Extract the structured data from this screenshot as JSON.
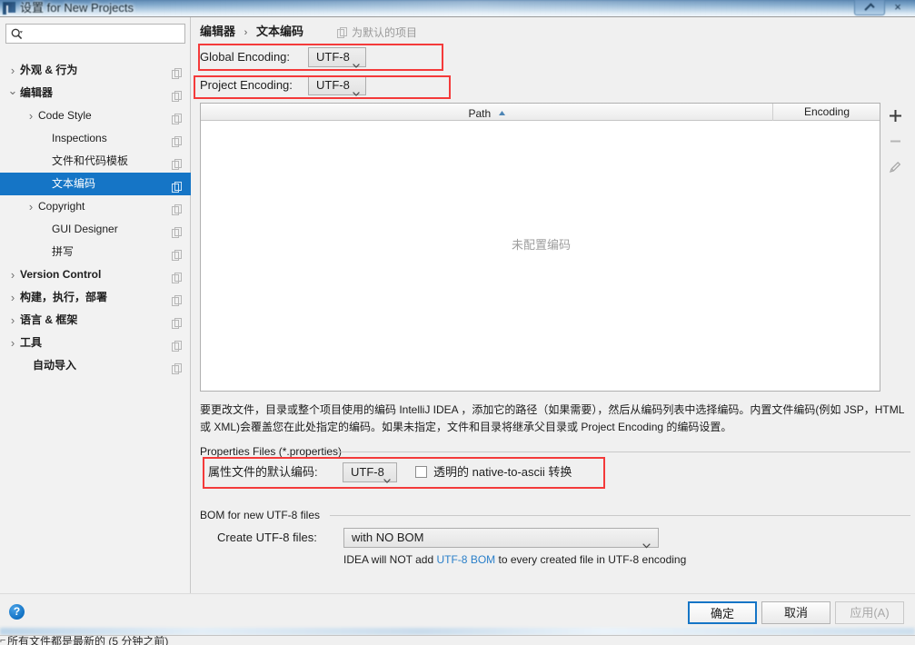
{
  "window": {
    "title": "设置 for New Projects",
    "close_label": "×",
    "app_icon": "intellij-idea-icon"
  },
  "search": {
    "value": "",
    "placeholder": ""
  },
  "sidebar": {
    "items": [
      {
        "label": "外观 & 行为",
        "indent": 8,
        "twist": "collapsed",
        "bold": true,
        "selected": false,
        "copy": true
      },
      {
        "label": "编辑器",
        "indent": 8,
        "twist": "expanded",
        "bold": true,
        "selected": false,
        "copy": true
      },
      {
        "label": "Code Style",
        "indent": 28,
        "twist": "collapsed",
        "bold": false,
        "selected": false,
        "copy": true
      },
      {
        "label": "Inspections",
        "indent": 43,
        "twist": "none",
        "bold": false,
        "selected": false,
        "copy": true
      },
      {
        "label": "文件和代码模板",
        "indent": 43,
        "twist": "none",
        "bold": false,
        "selected": false,
        "copy": true
      },
      {
        "label": "文本编码",
        "indent": 43,
        "twist": "none",
        "bold": false,
        "selected": true,
        "copy": true
      },
      {
        "label": "Copyright",
        "indent": 28,
        "twist": "collapsed",
        "bold": false,
        "selected": false,
        "copy": true
      },
      {
        "label": "GUI Designer",
        "indent": 43,
        "twist": "none",
        "bold": false,
        "selected": false,
        "copy": true
      },
      {
        "label": "拼写",
        "indent": 43,
        "twist": "none",
        "bold": false,
        "selected": false,
        "copy": true
      },
      {
        "label": "Version Control",
        "indent": 8,
        "twist": "collapsed",
        "bold": true,
        "selected": false,
        "copy": true
      },
      {
        "label": "构建，执行，部署",
        "indent": 8,
        "twist": "collapsed",
        "bold": true,
        "selected": false,
        "copy": true
      },
      {
        "label": "语言 & 框架",
        "indent": 8,
        "twist": "collapsed",
        "bold": true,
        "selected": false,
        "copy": true
      },
      {
        "label": "工具",
        "indent": 8,
        "twist": "collapsed",
        "bold": true,
        "selected": false,
        "copy": true
      },
      {
        "label": "自动导入",
        "indent": 22,
        "twist": "none",
        "bold": true,
        "selected": false,
        "copy": true
      }
    ]
  },
  "breadcrumb": {
    "root": "编辑器",
    "separator": "›",
    "leaf": "文本编码",
    "for_default": "为默认的项目"
  },
  "encoding": {
    "global_label": "Global Encoding:",
    "global_value": "UTF-8",
    "project_label": "Project Encoding:",
    "project_value": "UTF-8"
  },
  "table": {
    "columns": [
      "Path",
      "Encoding"
    ],
    "sort_column": "Path",
    "sort_direction": "ascending",
    "rows": [],
    "empty_message": "未配置编码",
    "buttons": [
      "add-icon",
      "remove-icon",
      "edit-pencil-icon"
    ],
    "add_label": "+",
    "remove_label": "−"
  },
  "description": "要更改文件，目录或整个项目使用的编码 IntelliJ IDEA ，添加它的路径（如果需要），然后从编码列表中选择编码。内置文件编码(例如 JSP，HTML 或 XML)会覆盖您在此处指定的编码。如果未指定，文件和目录将继承父目录或 Project Encoding 的编码设置。",
  "properties_group": {
    "title": "Properties Files (*.properties)",
    "default_encoding_label": "属性文件的默认编码:",
    "default_encoding_value": "UTF-8",
    "transparent_checkbox_label": "透明的 native-to-ascii 转换",
    "transparent_checkbox_checked": false
  },
  "bom_group": {
    "title": "BOM for new UTF-8 files",
    "create_label": "Create UTF-8 files:",
    "create_value": "with NO BOM",
    "hint_prefix": "IDEA will NOT add ",
    "hint_link": "UTF-8 BOM",
    "hint_suffix": " to every created file in UTF-8 encoding"
  },
  "footer": {
    "help": "?",
    "ok": "确定",
    "cancel": "取消",
    "apply": "应用(A)"
  },
  "ide_status": {
    "text": "所有文件都是最新的 (5 分钟之前)"
  },
  "colors": {
    "selection": "#1575c6",
    "highlight_box": "#f43a3a",
    "link": "#2a7fc9",
    "muted": "#9e9e9e"
  }
}
